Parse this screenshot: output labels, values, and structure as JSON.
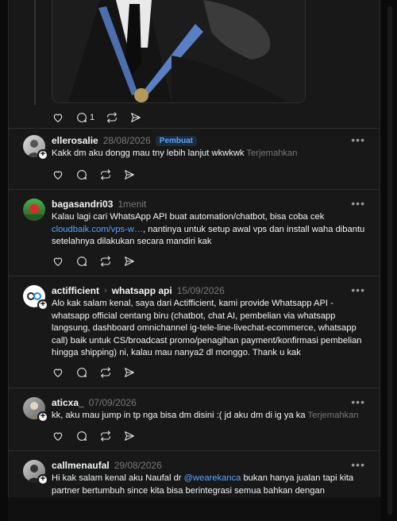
{
  "post": {
    "comment_count": "1"
  },
  "comments": [
    {
      "username": "ellerosalie",
      "time": "28/08/2026",
      "badge": "Pembuat",
      "text": "Kakk dm aku dongg mau tny lebih lanjut wkwkwk",
      "translate": "Terjemahkan"
    },
    {
      "username": "bagasandri03",
      "time": "1menit",
      "text_before": "Kalau lagi cari WhatsApp API buat automation/chatbot, bisa coba cek ",
      "link": "cloudbaik.com/vps-w…",
      "text_after": ", nantinya untuk setup awal vps dan install waha dibantu setelahnya dilakukan secara mandiri kak"
    },
    {
      "username": "actifficient",
      "topic": "whatsapp api",
      "time": "15/09/2026",
      "text": "Alo kak salam kenal, saya dari Actifficient, kami provide Whatsapp API - whatsapp official centang biru (chatbot, chat AI, pembelian via whatsapp langsung, dashboard omnichannel ig-tele-line-livechat-ecommerce, whatsapp call) baik untuk CS/broadcast promo/penagihan payment/konfirmasi pembelian hingga shipping) ni, kalau mau nanya2 dl monggo. Thank u kak"
    },
    {
      "username": "aticxa_",
      "time": "07/09/2026",
      "text": "kk, aku mau jump in tp nga bisa dm disini :( jd aku dm di ig ya ka",
      "translate": "Terjemahkan"
    },
    {
      "username": "callmenaufal",
      "time": "29/08/2026",
      "text_before": "Hi kak salam kenal aku Naufal dr ",
      "mention": "@wearekanca",
      "text_after": " bukan hanya jualan tapi kita partner bertumbuh since kita bisa berintegrasi semua bahkan dengan"
    }
  ],
  "icons": {
    "like": "heart-icon",
    "reply": "comment-icon",
    "repost": "repost-icon",
    "share": "send-icon",
    "more": "more-icon"
  },
  "colors": {
    "background": "#181818",
    "link": "#5aa4ff",
    "muted": "#777777"
  }
}
